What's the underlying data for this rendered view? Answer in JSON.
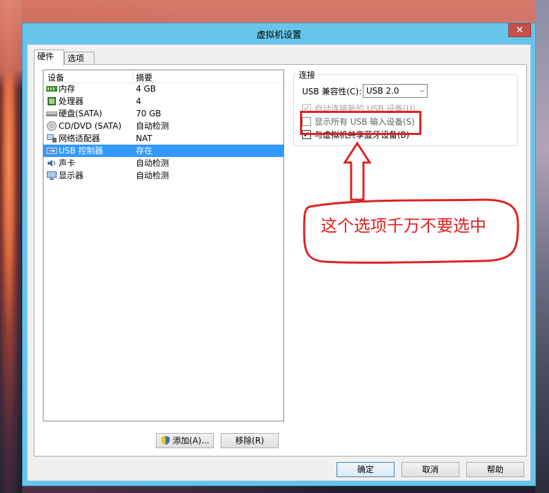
{
  "window": {
    "title": "虚拟机设置",
    "close_label": "✕"
  },
  "tabs": [
    {
      "label": "硬件"
    },
    {
      "label": "选项"
    }
  ],
  "device_list": {
    "columns": {
      "device": "设备",
      "summary": "摘要"
    },
    "rows": [
      {
        "name": "内存",
        "value": "4 GB",
        "icon": "memory-icon"
      },
      {
        "name": "处理器",
        "value": "4",
        "icon": "processor-icon"
      },
      {
        "name": "硬盘(SATA)",
        "value": "70 GB",
        "icon": "hard-disk-icon"
      },
      {
        "name": "CD/DVD (SATA)",
        "value": "自动检测",
        "icon": "cd-dvd-icon"
      },
      {
        "name": "网络适配器",
        "value": "NAT",
        "icon": "network-adapter-icon"
      },
      {
        "name": "USB 控制器",
        "value": "存在",
        "icon": "usb-controller-icon",
        "selected": true
      },
      {
        "name": "声卡",
        "value": "自动检测",
        "icon": "sound-card-icon"
      },
      {
        "name": "显示器",
        "value": "自动检测",
        "icon": "display-icon"
      }
    ]
  },
  "buttons": {
    "add": "添加(A)...",
    "remove": "移除(R)",
    "ok": "确定",
    "cancel": "取消",
    "help": "帮助"
  },
  "connection": {
    "title": "连接",
    "compat_label": "USB 兼容性(C):",
    "compat_value": "USB 2.0",
    "auto_connect": "自动连接新的 USB 设备(U)",
    "show_all": "显示所有 USB 输入设备(S)",
    "share_bluetooth": "与虚拟机共享蓝牙设备(B)"
  },
  "annotation": {
    "text": "这个选项千万不要选中"
  },
  "colors": {
    "title_bar": "#66c5ea",
    "selection": "#3399ff",
    "annotation": "#e02020"
  }
}
